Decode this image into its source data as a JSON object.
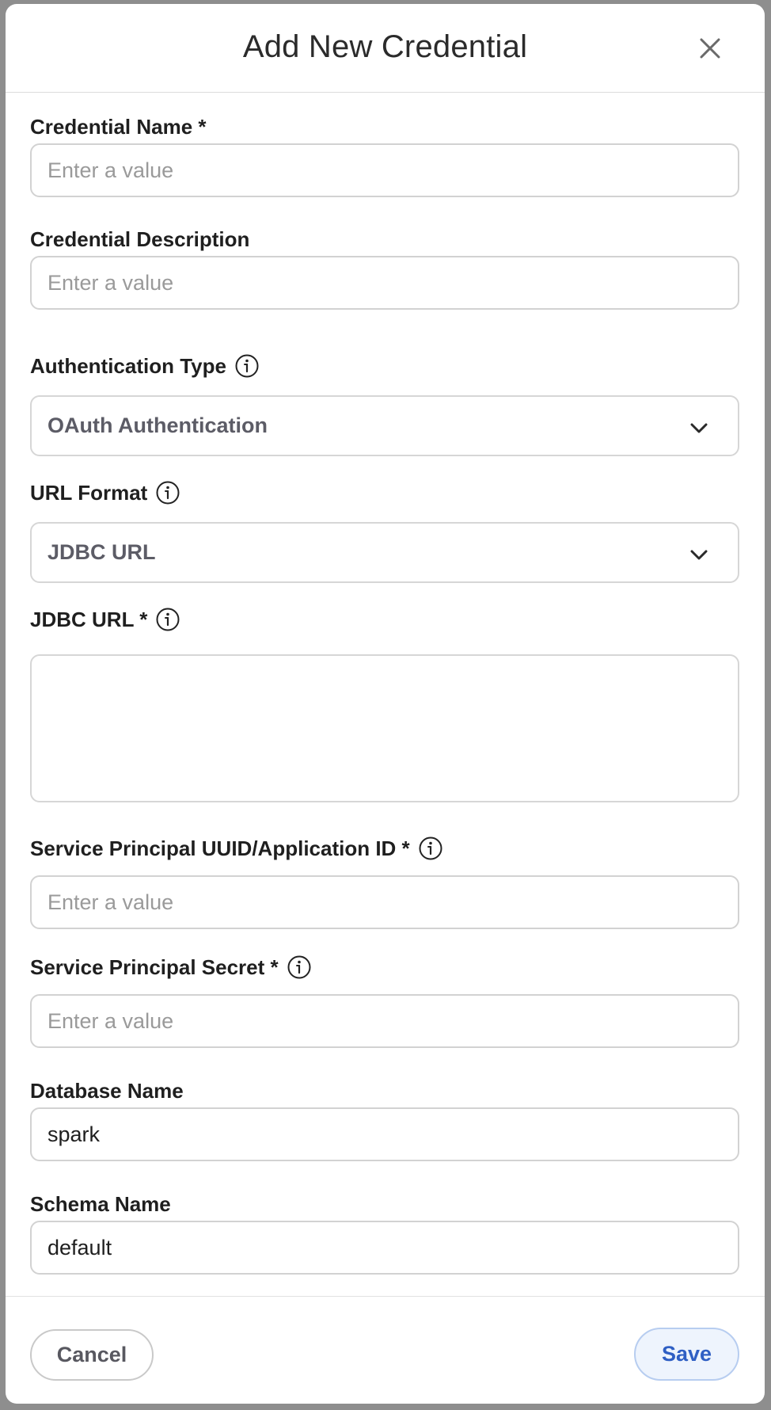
{
  "modal": {
    "title": "Add New Credential",
    "close_icon": "close-icon"
  },
  "fields": {
    "credential_name": {
      "label": "Credential Name *",
      "placeholder": "Enter a value",
      "value": ""
    },
    "credential_description": {
      "label": "Credential Description",
      "placeholder": "Enter a value",
      "value": ""
    },
    "authentication_type": {
      "label": "Authentication Type",
      "selected": "OAuth Authentication",
      "info_icon": "info-icon"
    },
    "url_format": {
      "label": "URL Format",
      "selected": "JDBC URL",
      "info_icon": "info-icon"
    },
    "jdbc_url": {
      "label": "JDBC URL *",
      "value": "",
      "info_icon": "info-icon"
    },
    "service_principal_id": {
      "label": "Service Principal UUID/Application ID *",
      "placeholder": "Enter a value",
      "value": "",
      "info_icon": "info-icon"
    },
    "service_principal_secret": {
      "label": "Service Principal Secret *",
      "placeholder": "Enter a value",
      "value": "",
      "info_icon": "info-icon"
    },
    "database_name": {
      "label": "Database Name",
      "value": "spark"
    },
    "schema_name": {
      "label": "Schema Name",
      "value": "default"
    }
  },
  "footer": {
    "cancel_label": "Cancel",
    "save_label": "Save"
  },
  "colors": {
    "accent": "#2f5fc4",
    "save_bg": "#eef4fd",
    "border": "#d2d2d2",
    "backdrop": "#8e8e8e"
  }
}
